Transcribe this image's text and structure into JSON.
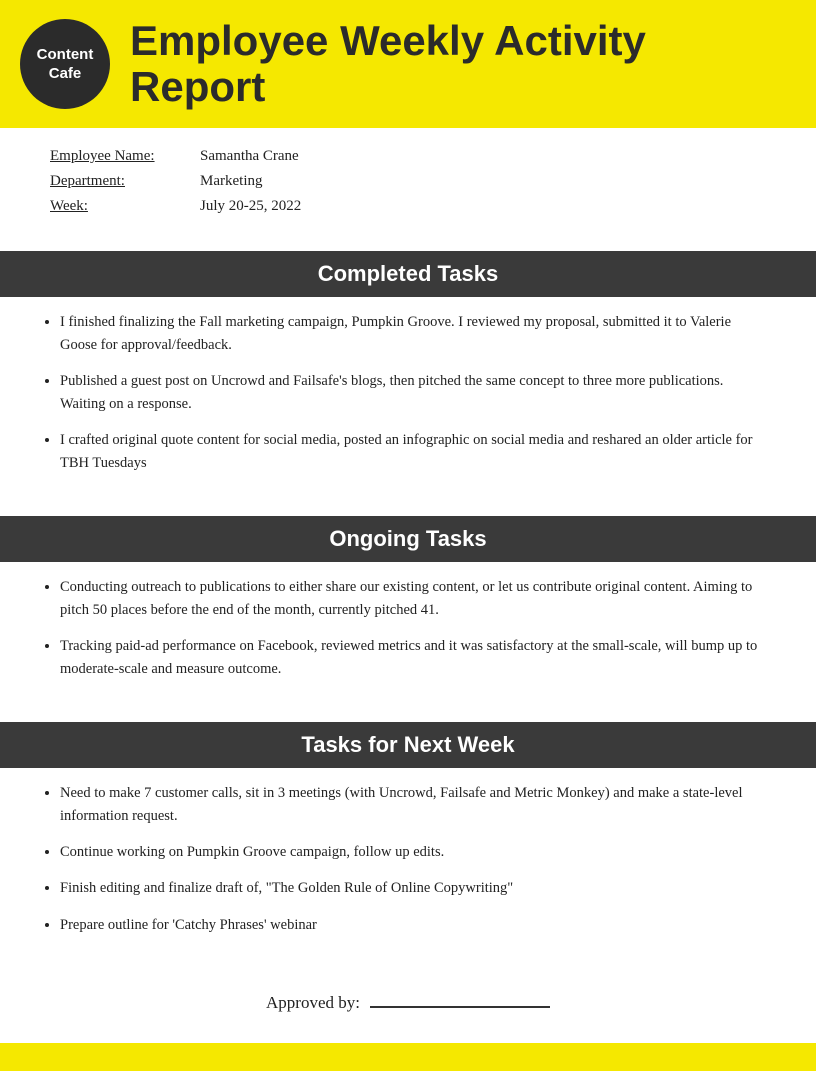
{
  "header": {
    "logo_line1": "Content",
    "logo_line2": "Cafe",
    "title": "Employee Weekly Activity Report"
  },
  "info": {
    "employee_label": "Employee Name:",
    "employee_value": "Samantha Crane",
    "department_label": "Department:",
    "department_value": "Marketing",
    "week_label": "Week:",
    "week_value": "July 20-25, 2022"
  },
  "sections": {
    "completed": {
      "title": "Completed Tasks",
      "items": [
        "I finished finalizing the Fall marketing campaign, Pumpkin Groove. I reviewed my proposal, submitted it to Valerie Goose for approval/feedback.",
        "Published a guest post on Uncrowd and Failsafe's blogs, then pitched the same concept to three more publications. Waiting on a response.",
        "I crafted original quote content for social media, posted an infographic on social media and reshared an older article for TBH Tuesdays"
      ]
    },
    "ongoing": {
      "title": "Ongoing Tasks",
      "items": [
        "Conducting outreach to publications to either share our existing content, or let us contribute original content. Aiming to pitch 50 places before the end of the month, currently pitched 41.",
        "Tracking paid-ad performance on Facebook, reviewed metrics and it was satisfactory at the small-scale, will bump up to moderate-scale and measure outcome."
      ]
    },
    "next_week": {
      "title": "Tasks for Next Week",
      "items": [
        "Need to make 7 customer calls, sit in 3 meetings (with Uncrowd, Failsafe and Metric Monkey) and make a state-level information request.",
        "Continue working on Pumpkin Groove campaign, follow up edits.",
        "Finish editing and finalize draft of, \"The Golden Rule of Online Copywriting\"",
        "Prepare outline for 'Catchy Phrases' webinar"
      ]
    }
  },
  "footer": {
    "approved_label": "Approved by:"
  }
}
